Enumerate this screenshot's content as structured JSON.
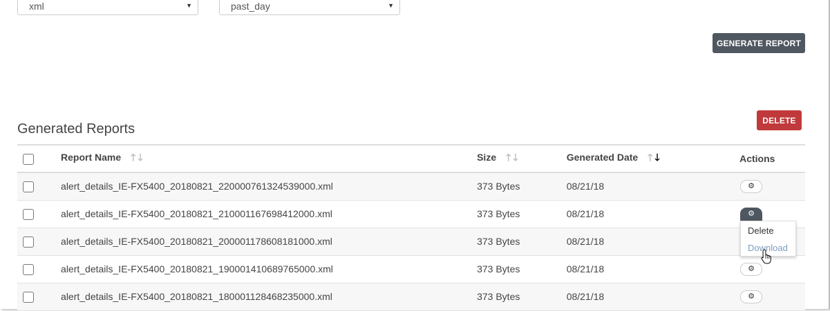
{
  "filters": {
    "format_value": "xml",
    "range_value": "past_day"
  },
  "toolbar": {
    "generate_label": "GENERATE REPORT",
    "delete_label": "DELETE"
  },
  "section": {
    "title": "Generated Reports"
  },
  "table": {
    "headers": {
      "name": "Report Name",
      "size": "Size",
      "date": "Generated Date",
      "actions": "Actions"
    },
    "rows": [
      {
        "name": "alert_details_IE-FX5400_20180821_220000761324539000.xml",
        "size": "373 Bytes",
        "date": "08/21/18"
      },
      {
        "name": "alert_details_IE-FX5400_20180821_210001167698412000.xml",
        "size": "373 Bytes",
        "date": "08/21/18"
      },
      {
        "name": "alert_details_IE-FX5400_20180821_200001178608181000.xml",
        "size": "373 Bytes",
        "date": "08/21/18"
      },
      {
        "name": "alert_details_IE-FX5400_20180821_190001410689765000.xml",
        "size": "373 Bytes",
        "date": "08/21/18"
      },
      {
        "name": "alert_details_IE-FX5400_20180821_180001128468235000.xml",
        "size": "373 Bytes",
        "date": "08/21/18"
      }
    ]
  },
  "action_menu": {
    "delete_label": "Delete",
    "download_label": "Download"
  },
  "colors": {
    "primary_button": "#4f5761",
    "danger_button": "#c0393b",
    "link_hover": "#7b9bbd"
  },
  "icons": {
    "sort": "sort-arrows-icon",
    "gear": "gear-icon",
    "cursor": "hand-pointer-icon"
  }
}
